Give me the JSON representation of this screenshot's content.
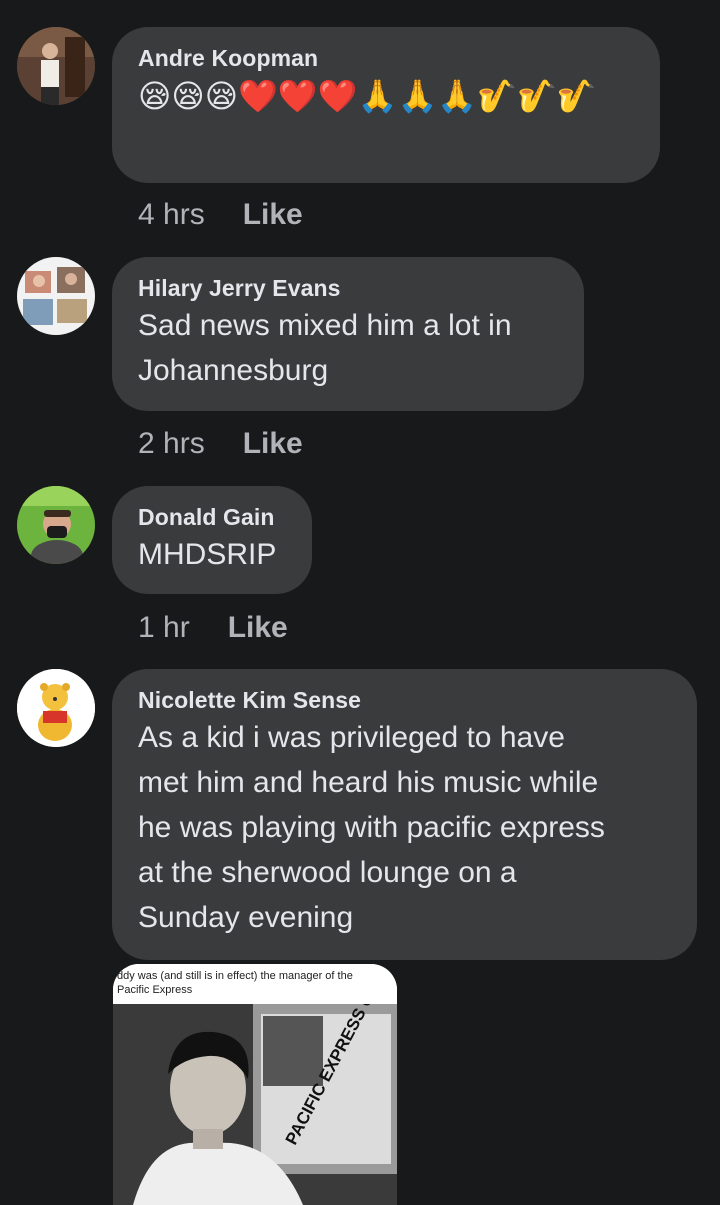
{
  "comments": [
    {
      "author": "Andre Koopman",
      "reaction_emojis": "😪😪😪❤️❤️❤️🙏🙏🙏🎷🎷🎷",
      "time": "4 hrs",
      "like_label": "Like"
    },
    {
      "author": "Hilary Jerry Evans",
      "text_line1": "Sad news mixed him a lot in",
      "text_line2": "Johannesburg",
      "time": "2 hrs",
      "like_label": "Like"
    },
    {
      "author": "Donald Gain",
      "text": "MHDSRIP",
      "time": "1 hr",
      "like_label": "Like"
    },
    {
      "author": "Nicolette Kim Sense",
      "text_lines": [
        "As a kid i was privileged to have",
        "met him and heard his music while",
        "he was playing with pacific express",
        "at the sherwood lounge on a",
        "Sunday evening"
      ],
      "attachment": {
        "caption_line1": "ddy was (and still is in effect) the manager of the",
        "caption_line2": "Pacific Express",
        "poster_text": "PACIFIC EXPRESS CONCERT"
      }
    }
  ],
  "colors": {
    "background": "#18191a",
    "bubble": "#3a3b3c",
    "primary_text": "#e4e6eb",
    "secondary_text": "#b0b3b8"
  }
}
